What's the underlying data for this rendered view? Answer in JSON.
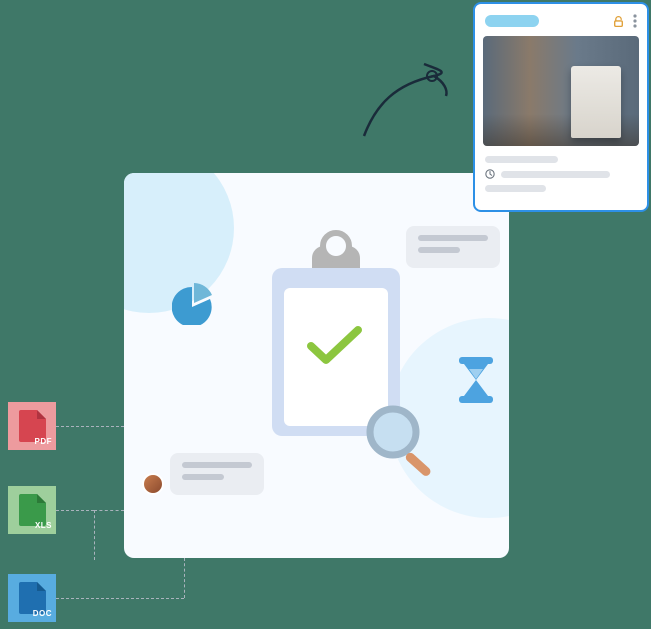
{
  "files": {
    "pdf_label": "PDF",
    "xls_label": "XLS",
    "doc_label": "DOC"
  },
  "colors": {
    "pdf_bg": "#ed9b9e",
    "xls_bg": "#9ecf9c",
    "doc_bg": "#58ace0",
    "accent": "#2d90e6",
    "check": "#8cc63f"
  }
}
